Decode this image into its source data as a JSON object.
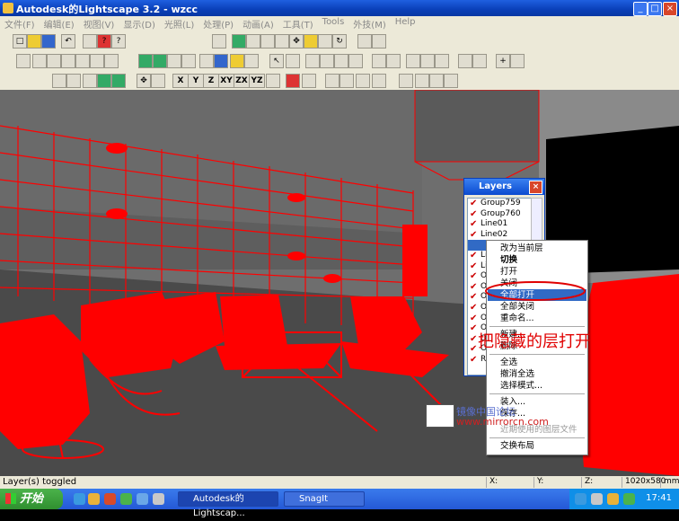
{
  "window": {
    "title": "Autodesk的Lightscape 3.2 - wzcc",
    "minimize": "_",
    "maximize": "□",
    "close": "×"
  },
  "menu": [
    "文件(F)",
    "编辑(E)",
    "视图(V)",
    "显示(D)",
    "光照(L)",
    "处理(P)",
    "动画(A)",
    "工具(T)",
    "Tools",
    "外技(M)",
    "Help"
  ],
  "toolbar": {
    "axis_buttons": [
      "X",
      "Y",
      "Z",
      "XY",
      "ZX",
      "YZ"
    ]
  },
  "layers_panel": {
    "title": "Layers",
    "items": [
      "Group759",
      "Group760",
      "Line01",
      "Line02",
      "",
      "Li",
      "Li",
      "Ob",
      "Ob",
      "Ob",
      "Ob",
      "Ob",
      "Ob",
      "Ob",
      "Om",
      "Ro"
    ]
  },
  "context_menu": {
    "items": [
      {
        "label": "改为当前层",
        "state": "normal"
      },
      {
        "label": "切换",
        "state": "normal"
      },
      {
        "label": "打开",
        "state": "normal"
      },
      {
        "label": "关闭",
        "state": "normal"
      },
      {
        "label": "全部打开",
        "state": "highlighted"
      },
      {
        "label": "全部关闭",
        "state": "normal"
      },
      {
        "label": "重命名...",
        "state": "normal"
      },
      {
        "label": "新建...",
        "state": "normal"
      },
      {
        "label": "删除",
        "state": "normal"
      },
      {
        "label": "全选",
        "state": "normal"
      },
      {
        "label": "撤消全选",
        "state": "normal"
      },
      {
        "label": "选择模式...",
        "state": "normal"
      },
      {
        "label": "装入...",
        "state": "normal"
      },
      {
        "label": "保存...",
        "state": "normal"
      },
      {
        "label": "近期使用的图层文件",
        "state": "disabled"
      },
      {
        "label": "交换布局",
        "state": "normal"
      }
    ]
  },
  "annotation": {
    "text": "把隐藏的层打开",
    "color": "#e00000"
  },
  "watermark": {
    "line1": "镜像中国论坛",
    "line2": "www.mirrorcn.com"
  },
  "statusbar": {
    "message": "Layer(s) toggled",
    "x_label": "X:",
    "y_label": "Y:",
    "z_label": "Z:",
    "resolution": "1020x580",
    "mode": "mm"
  },
  "taskbar": {
    "start": "开始",
    "tasks": [
      "Autodesk的Lightscap...",
      "SnagIt"
    ],
    "clock": "17:41"
  },
  "colors": {
    "wireframe": "#ff0000",
    "xp_blue": "#0a3fb8",
    "highlight": "#316ac5"
  }
}
